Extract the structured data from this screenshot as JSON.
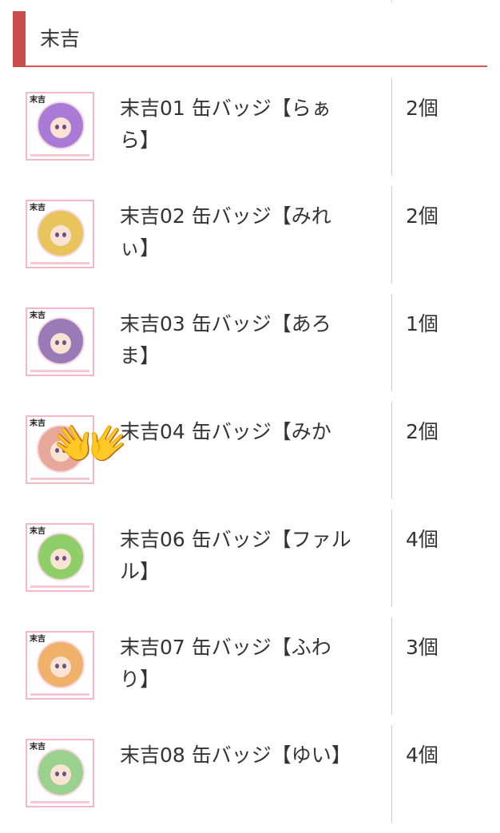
{
  "section": {
    "title": "末吉"
  },
  "items": [
    {
      "name": "末吉01 缶バッジ【らぁら】",
      "quantity": "2個",
      "badge_color": "#a97bd6",
      "character": "purple-hair"
    },
    {
      "name": "末吉02 缶バッジ【みれぃ】",
      "quantity": "2個",
      "badge_color": "#e9c35b",
      "character": "blonde-twin-tails"
    },
    {
      "name": "末吉03 缶バッジ【あろま】",
      "quantity": "1個",
      "badge_color": "#9a7bb8",
      "character": "brown-hair"
    },
    {
      "name": "末吉04 缶バッジ【みか",
      "quantity": "2個",
      "badge_color": "#e7a89a",
      "character": "red-hair"
    },
    {
      "name": "末吉06 缶バッジ【ファルル】",
      "quantity": "4個",
      "badge_color": "#8fcf69",
      "character": "green-hair"
    },
    {
      "name": "末吉07 缶バッジ【ふわり】",
      "quantity": "3個",
      "badge_color": "#f0b16a",
      "character": "light-green-hair"
    },
    {
      "name": "末吉08 缶バッジ【ゆい】",
      "quantity": "4個",
      "badge_color": "#9bd18e",
      "character": "blonde-hair"
    }
  ],
  "overlay": {
    "emoji": "👐",
    "icon": "raised-hands-icon"
  },
  "thumb_tag": "末吉"
}
